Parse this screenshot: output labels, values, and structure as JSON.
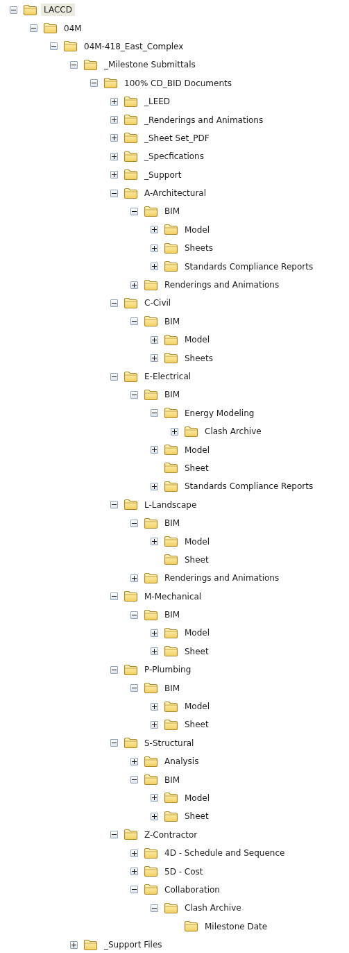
{
  "tree": [
    {
      "label": "LACCD",
      "kind": "branch",
      "expanded": true,
      "selected": true,
      "children": [
        {
          "label": "04M",
          "kind": "branch",
          "expanded": true,
          "selected": false,
          "children": [
            {
              "label": "04M-418_East_Complex",
              "kind": "branch",
              "expanded": true,
              "selected": false,
              "children": [
                {
                  "label": "_Milestone Submittals",
                  "kind": "branch",
                  "expanded": true,
                  "selected": false,
                  "children": [
                    {
                      "label": "100% CD_BID Documents",
                      "kind": "branch",
                      "expanded": true,
                      "selected": false,
                      "children": [
                        {
                          "label": "_LEED",
                          "kind": "branch",
                          "expanded": false,
                          "selected": false
                        },
                        {
                          "label": "_Renderings and Animations",
                          "kind": "branch",
                          "expanded": false,
                          "selected": false
                        },
                        {
                          "label": "_Sheet Set_PDF",
                          "kind": "branch",
                          "expanded": false,
                          "selected": false
                        },
                        {
                          "label": "_Specfications",
                          "kind": "branch",
                          "expanded": false,
                          "selected": false
                        },
                        {
                          "label": "_Support",
                          "kind": "branch",
                          "expanded": false,
                          "selected": false
                        },
                        {
                          "label": "A-Architectural",
                          "kind": "branch",
                          "expanded": true,
                          "selected": false,
                          "children": [
                            {
                              "label": "BIM",
                              "kind": "branch",
                              "expanded": true,
                              "selected": false,
                              "children": [
                                {
                                  "label": "Model",
                                  "kind": "branch",
                                  "expanded": false,
                                  "selected": false
                                },
                                {
                                  "label": "Sheets",
                                  "kind": "branch",
                                  "expanded": false,
                                  "selected": false
                                },
                                {
                                  "label": "Standards Compliance Reports",
                                  "kind": "branch",
                                  "expanded": false,
                                  "selected": false
                                }
                              ]
                            },
                            {
                              "label": "Renderings and Animations",
                              "kind": "branch",
                              "expanded": false,
                              "selected": false
                            }
                          ]
                        },
                        {
                          "label": "C-Civil",
                          "kind": "branch",
                          "expanded": true,
                          "selected": false,
                          "children": [
                            {
                              "label": "BIM",
                              "kind": "branch",
                              "expanded": true,
                              "selected": false,
                              "children": [
                                {
                                  "label": "Model",
                                  "kind": "branch",
                                  "expanded": false,
                                  "selected": false
                                },
                                {
                                  "label": "Sheets",
                                  "kind": "branch",
                                  "expanded": false,
                                  "selected": false
                                }
                              ]
                            }
                          ]
                        },
                        {
                          "label": "E-Electrical",
                          "kind": "branch",
                          "expanded": true,
                          "selected": false,
                          "children": [
                            {
                              "label": "BIM",
                              "kind": "branch",
                              "expanded": true,
                              "selected": false,
                              "children": [
                                {
                                  "label": "Energy Modeling",
                                  "kind": "branch",
                                  "expanded": true,
                                  "selected": false,
                                  "children": [
                                    {
                                      "label": "Clash Archive",
                                      "kind": "branch",
                                      "expanded": false,
                                      "selected": false
                                    }
                                  ]
                                },
                                {
                                  "label": "Model",
                                  "kind": "branch",
                                  "expanded": false,
                                  "selected": false
                                },
                                {
                                  "label": "Sheet",
                                  "kind": "leaf",
                                  "selected": false
                                },
                                {
                                  "label": "Standards Compliance Reports",
                                  "kind": "branch",
                                  "expanded": false,
                                  "selected": false
                                }
                              ]
                            }
                          ]
                        },
                        {
                          "label": "L-Landscape",
                          "kind": "branch",
                          "expanded": true,
                          "selected": false,
                          "children": [
                            {
                              "label": "BIM",
                              "kind": "branch",
                              "expanded": true,
                              "selected": false,
                              "children": [
                                {
                                  "label": "Model",
                                  "kind": "branch",
                                  "expanded": false,
                                  "selected": false
                                },
                                {
                                  "label": "Sheet",
                                  "kind": "leaf",
                                  "selected": false
                                }
                              ]
                            },
                            {
                              "label": "Renderings and Animations",
                              "kind": "branch",
                              "expanded": false,
                              "selected": false
                            }
                          ]
                        },
                        {
                          "label": "M-Mechanical",
                          "kind": "branch",
                          "expanded": true,
                          "selected": false,
                          "children": [
                            {
                              "label": "BIM",
                              "kind": "branch",
                              "expanded": true,
                              "selected": false,
                              "children": [
                                {
                                  "label": "Model",
                                  "kind": "branch",
                                  "expanded": false,
                                  "selected": false
                                },
                                {
                                  "label": "Sheet",
                                  "kind": "branch",
                                  "expanded": false,
                                  "selected": false
                                }
                              ]
                            }
                          ]
                        },
                        {
                          "label": "P-Plumbing",
                          "kind": "branch",
                          "expanded": true,
                          "selected": false,
                          "children": [
                            {
                              "label": "BIM",
                              "kind": "branch",
                              "expanded": true,
                              "selected": false,
                              "children": [
                                {
                                  "label": "Model",
                                  "kind": "branch",
                                  "expanded": false,
                                  "selected": false
                                },
                                {
                                  "label": "Sheet",
                                  "kind": "branch",
                                  "expanded": false,
                                  "selected": false
                                }
                              ]
                            }
                          ]
                        },
                        {
                          "label": "S-Structural",
                          "kind": "branch",
                          "expanded": true,
                          "selected": false,
                          "children": [
                            {
                              "label": "Analysis",
                              "kind": "branch",
                              "expanded": false,
                              "selected": false
                            },
                            {
                              "label": "BIM",
                              "kind": "branch",
                              "expanded": true,
                              "selected": false,
                              "children": [
                                {
                                  "label": "Model",
                                  "kind": "branch",
                                  "expanded": false,
                                  "selected": false
                                },
                                {
                                  "label": "Sheet",
                                  "kind": "branch",
                                  "expanded": false,
                                  "selected": false
                                }
                              ]
                            }
                          ]
                        },
                        {
                          "label": "Z-Contractor",
                          "kind": "branch",
                          "expanded": true,
                          "selected": false,
                          "children": [
                            {
                              "label": "4D - Schedule and Sequence",
                              "kind": "branch",
                              "expanded": false,
                              "selected": false
                            },
                            {
                              "label": "5D - Cost",
                              "kind": "branch",
                              "expanded": false,
                              "selected": false
                            },
                            {
                              "label": "Collaboration",
                              "kind": "branch",
                              "expanded": true,
                              "selected": false,
                              "children": [
                                {
                                  "label": "Clash Archive",
                                  "kind": "branch",
                                  "expanded": true,
                                  "selected": false,
                                  "children": [
                                    {
                                      "label": "Milestone Date",
                                      "kind": "leaf",
                                      "selected": false
                                    }
                                  ]
                                }
                              ]
                            }
                          ]
                        }
                      ]
                    }
                  ]
                },
                {
                  "label": "_Support Files",
                  "kind": "branch",
                  "expanded": false,
                  "selected": false
                }
              ]
            }
          ]
        }
      ]
    }
  ]
}
